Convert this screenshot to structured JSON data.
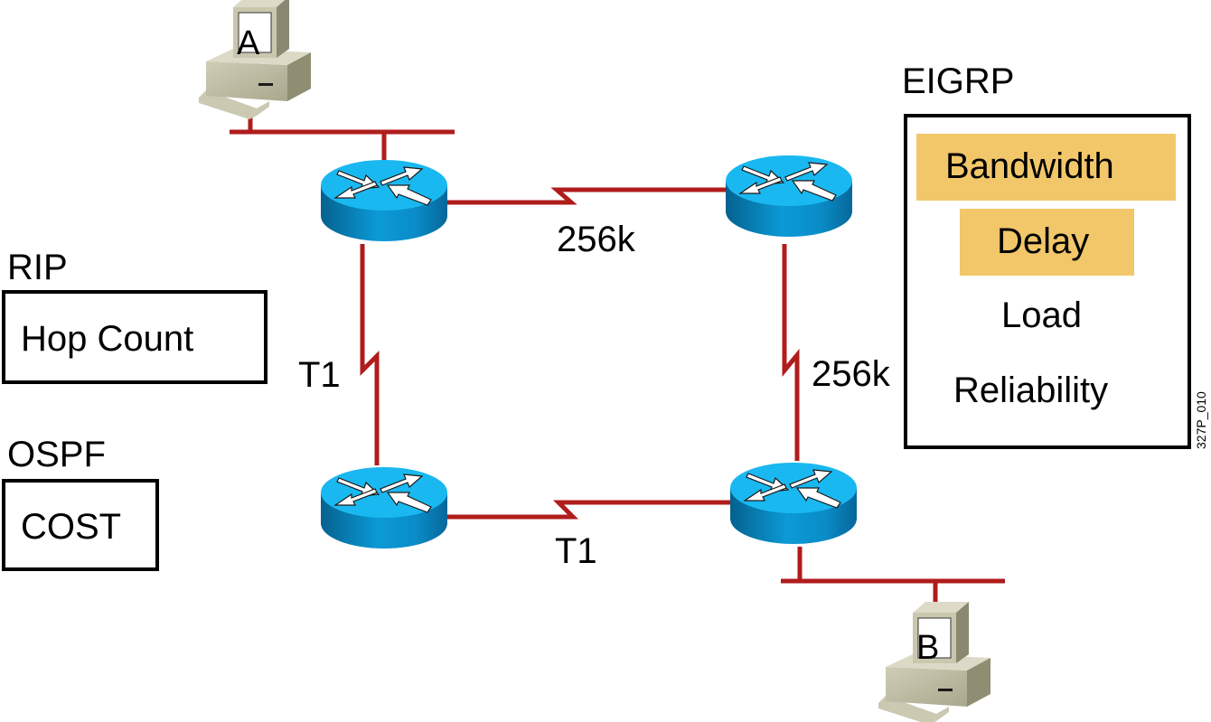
{
  "hosts": {
    "a": {
      "label": "A"
    },
    "b": {
      "label": "B"
    }
  },
  "links": {
    "top": {
      "label": "256k",
      "type": "serial"
    },
    "left": {
      "label": "T1",
      "type": "serial"
    },
    "right": {
      "label": "256k",
      "type": "serial"
    },
    "bottom": {
      "label": "T1",
      "type": "serial"
    }
  },
  "protocols": {
    "rip": {
      "title": "RIP",
      "metrics": [
        "Hop Count"
      ]
    },
    "ospf": {
      "title": "OSPF",
      "metrics": [
        "COST"
      ]
    },
    "eigrp": {
      "title": "EIGRP",
      "metrics": [
        {
          "label": "Bandwidth",
          "highlighted": true
        },
        {
          "label": "Delay",
          "highlighted": true
        },
        {
          "label": "Load",
          "highlighted": false
        },
        {
          "label": "Reliability",
          "highlighted": false
        }
      ]
    }
  },
  "figure_id": "327P_010",
  "colors": {
    "link": "#b01c1c",
    "router_top": "#19b7ef",
    "router_side": "#0a86bf",
    "highlight": "#f2c76a",
    "computer": "#c9c7ae"
  }
}
